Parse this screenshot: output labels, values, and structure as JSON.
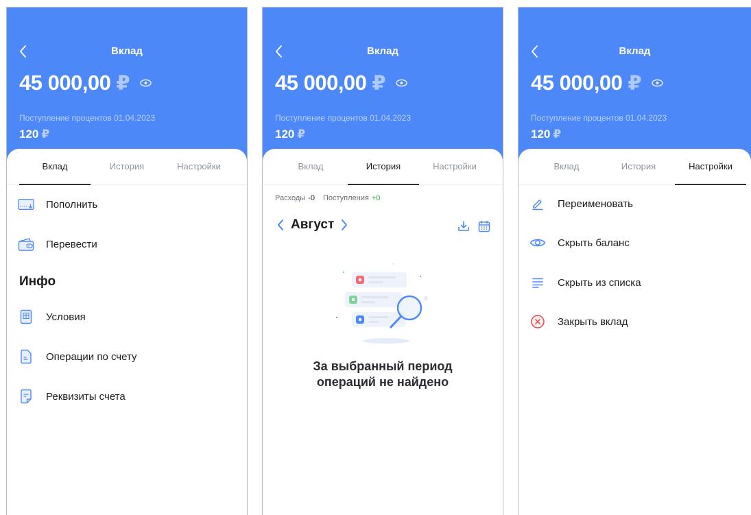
{
  "colors": {
    "accent": "#4d88f9",
    "positive": "#27b03f",
    "danger": "#e5484d"
  },
  "deposit": {
    "title": "Вклад",
    "balance": "45 000,00",
    "currency": "₽",
    "interest_label": "Поступление процентов 01.04.2023",
    "interest_value": "120",
    "interest_currency": "₽"
  },
  "tabs": [
    "Вклад",
    "История",
    "Настройки"
  ],
  "screens": [
    {
      "active_tab": 0,
      "actions": [
        {
          "label": "Пополнить",
          "icon": "top-up-card-icon"
        },
        {
          "label": "Перевести",
          "icon": "wallet-transfer-icon"
        }
      ],
      "info_title": "Инфо",
      "info_items": [
        {
          "label": "Условия",
          "icon": "conditions-document-icon"
        },
        {
          "label": "Операции по счету",
          "icon": "operations-document-icon"
        },
        {
          "label": "Реквизиты счета",
          "icon": "requisites-document-icon"
        }
      ]
    },
    {
      "active_tab": 1,
      "expenses_label": "Расходы",
      "expenses_value": "-0",
      "income_label": "Поступления",
      "income_value": "+0",
      "month": "Август",
      "empty_line1": "За выбранный период",
      "empty_line2": "операций не найдено"
    },
    {
      "active_tab": 2,
      "settings": [
        {
          "label": "Переименовать",
          "icon": "pencil-icon"
        },
        {
          "label": "Скрыть баланс",
          "icon": "eye-icon"
        },
        {
          "label": "Скрыть из списка",
          "icon": "list-icon"
        },
        {
          "label": "Закрыть вклад",
          "icon": "close-circle-icon"
        }
      ]
    }
  ]
}
